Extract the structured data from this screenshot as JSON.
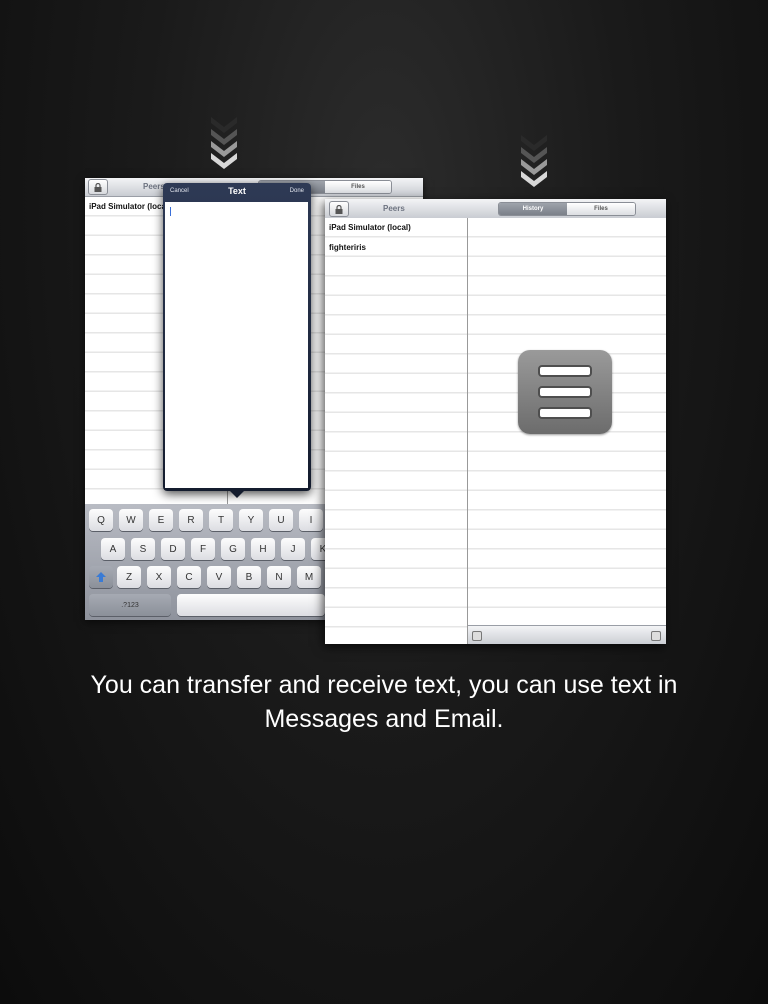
{
  "back_screen": {
    "sidebar_title": "Peers",
    "tab_files": "Files",
    "peers": [
      "iPad Simulator (local)"
    ]
  },
  "popover": {
    "cancel": "Cancel",
    "title": "Text",
    "done": "Done"
  },
  "keyboard": {
    "row1": [
      "Q",
      "W",
      "E",
      "R",
      "T",
      "Y",
      "U",
      "I"
    ],
    "row2": [
      "A",
      "S",
      "D",
      "F",
      "G",
      "H",
      "J",
      "K"
    ],
    "row3": [
      "Z",
      "X",
      "C",
      "V",
      "B",
      "N",
      "M"
    ],
    "numbers_key": ".?123"
  },
  "front_screen": {
    "sidebar_title": "Peers",
    "tabs": [
      "History",
      "Files"
    ],
    "selected_tab": "History",
    "peers": [
      "iPad Simulator (local)",
      "fighteriris"
    ],
    "empty_state_icon": "menu-list-icon"
  },
  "caption": "You can transfer and receive text, you can use text in Messages and Email."
}
